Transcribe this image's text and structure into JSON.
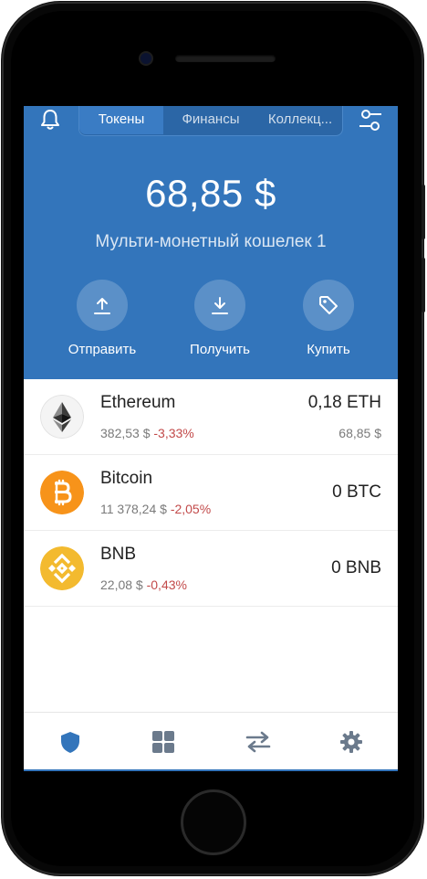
{
  "header": {
    "tabs": [
      {
        "label": "Токены",
        "active": true
      },
      {
        "label": "Финансы",
        "active": false
      },
      {
        "label": "Коллекц...",
        "active": false
      }
    ],
    "balance": "68,85 $",
    "wallet_name": "Мульти-монетный кошелек 1",
    "actions": [
      {
        "label": "Отправить",
        "icon": "upload-icon"
      },
      {
        "label": "Получить",
        "icon": "download-icon"
      },
      {
        "label": "Купить",
        "icon": "tag-icon"
      }
    ]
  },
  "tokens": [
    {
      "name": "Ethereum",
      "price": "382,53 $",
      "change": "-3,33%",
      "amount": "0,18 ETH",
      "fiat": "68,85 $",
      "icon": "ethereum-icon"
    },
    {
      "name": "Bitcoin",
      "price": "11 378,24 $",
      "change": "-2,05%",
      "amount": "0 BTC",
      "fiat": "",
      "icon": "bitcoin-icon"
    },
    {
      "name": "BNB",
      "price": "22,08 $",
      "change": "-0,43%",
      "amount": "0 BNB",
      "fiat": "",
      "icon": "bnb-icon"
    }
  ],
  "bottom_nav": [
    {
      "icon": "shield-icon",
      "active": true
    },
    {
      "icon": "grid-icon",
      "active": false
    },
    {
      "icon": "swap-icon",
      "active": false
    },
    {
      "icon": "gear-icon",
      "active": false
    }
  ],
  "colors": {
    "primary": "#3375BB",
    "negative": "#C24A4A",
    "bitcoin": "#F7931A",
    "bnb": "#F3BA2F",
    "nav_inactive": "#6B7A8C"
  }
}
